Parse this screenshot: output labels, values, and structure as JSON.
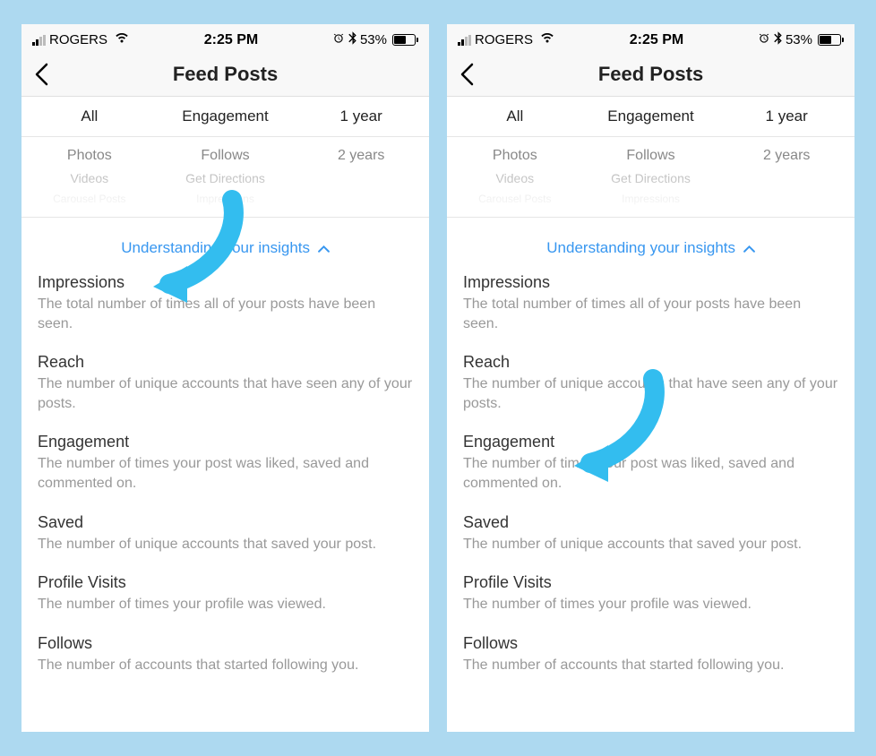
{
  "status": {
    "carrier": "ROGERS",
    "time": "2:25 PM",
    "battery_percent": "53%"
  },
  "nav": {
    "title": "Feed Posts"
  },
  "tabs": {
    "col1": "All",
    "col2": "Engagement",
    "col3": "1 year"
  },
  "picker": {
    "col1": [
      "Photos",
      "Videos",
      "Carousel Posts"
    ],
    "col2": [
      "Follows",
      "Get Directions",
      "Impressions"
    ],
    "col3": [
      "2 years"
    ]
  },
  "insights_link": "Understanding your insights",
  "definitions": [
    {
      "title": "Impressions",
      "desc": "The total number of times all of your posts have been seen."
    },
    {
      "title": "Reach",
      "desc": "The number of unique accounts that have seen any of your posts."
    },
    {
      "title": "Engagement",
      "desc": "The number of times your post was liked, saved and commented on."
    },
    {
      "title": "Saved",
      "desc": "The number of unique accounts that saved your post."
    },
    {
      "title": "Profile Visits",
      "desc": "The number of times your profile was viewed."
    },
    {
      "title": "Follows",
      "desc": "The number of accounts that started following you."
    }
  ],
  "arrow_color": "#33bdef"
}
